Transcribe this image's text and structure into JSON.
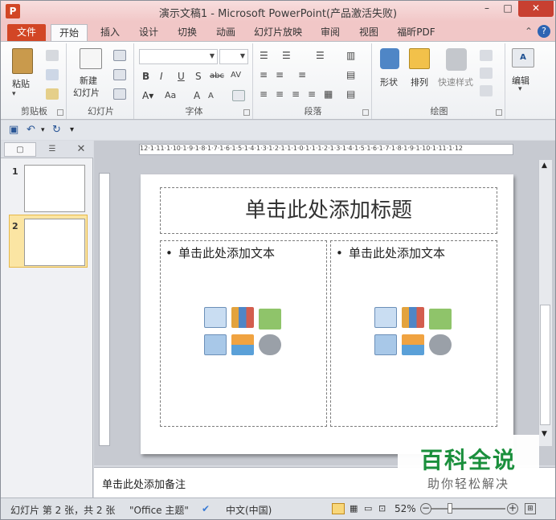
{
  "window": {
    "app_icon": "P",
    "title": "演示文稿1 - Microsoft PowerPoint(产品激活失败)",
    "minimize": "–",
    "maximize": "□",
    "close": "✕"
  },
  "tabs": [
    {
      "label": "文件"
    },
    {
      "label": "开始"
    },
    {
      "label": "插入"
    },
    {
      "label": "设计"
    },
    {
      "label": "切换"
    },
    {
      "label": "动画"
    },
    {
      "label": "幻灯片放映"
    },
    {
      "label": "审阅"
    },
    {
      "label": "视图"
    },
    {
      "label": "福昕PDF"
    }
  ],
  "ribbon": {
    "clipboard": {
      "paste": "粘贴",
      "group": "剪贴板"
    },
    "slides": {
      "new_slide_1": "新建",
      "new_slide_2": "幻灯片",
      "group": "幻灯片"
    },
    "font": {
      "bold": "B",
      "italic": "I",
      "underline": "U",
      "strike": "S",
      "abc": "abc",
      "aa": "Aa",
      "grow": "A",
      "shrink": "A",
      "group": "字体"
    },
    "paragraph": {
      "group": "段落"
    },
    "drawing": {
      "shapes": "形状",
      "arrange": "排列",
      "quick_styles": "快速样式",
      "group": "绘图"
    },
    "editing": {
      "edit": "编辑"
    }
  },
  "left_pane": {
    "close": "✕",
    "thumbs": [
      {
        "num": "1"
      },
      {
        "num": "2"
      }
    ]
  },
  "ruler": {
    "h": "12·1·11·1·10·1·9·1·8·1·7·1·6·1·5·1·4·1·3·1·2·1·1·1·0·1·1·1·2·1·3·1·4·1·5·1·6·1·7·1·8·1·9·1·10·1·11·1·12"
  },
  "slide": {
    "title_placeholder": "单击此处添加标题",
    "text_placeholder_left": "单击此处添加文本",
    "text_placeholder_right": "单击此处添加文本",
    "bullet": "•"
  },
  "notes": {
    "placeholder": "单击此处添加备注"
  },
  "watermark": {
    "title": "百科全说",
    "subtitle": "助你轻松解决"
  },
  "status": {
    "slide_info": "幻灯片 第 2 张，共 2 张",
    "theme": "\"Office 主题\"",
    "language": "中文(中国)",
    "zoom": "52%",
    "zoom_minus": "−",
    "zoom_plus": "+"
  }
}
